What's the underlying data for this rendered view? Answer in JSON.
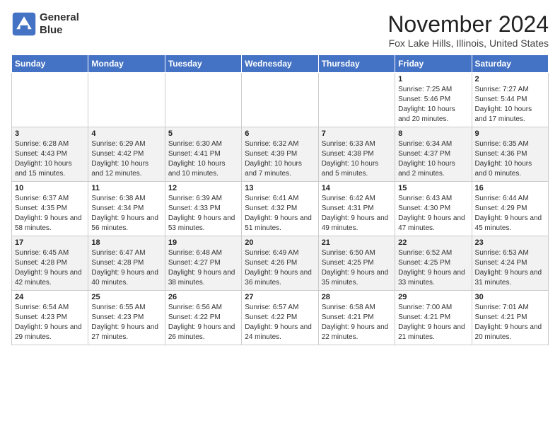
{
  "header": {
    "logo_line1": "General",
    "logo_line2": "Blue",
    "month": "November 2024",
    "location": "Fox Lake Hills, Illinois, United States"
  },
  "weekdays": [
    "Sunday",
    "Monday",
    "Tuesday",
    "Wednesday",
    "Thursday",
    "Friday",
    "Saturday"
  ],
  "weeks": [
    [
      {
        "day": "",
        "info": ""
      },
      {
        "day": "",
        "info": ""
      },
      {
        "day": "",
        "info": ""
      },
      {
        "day": "",
        "info": ""
      },
      {
        "day": "",
        "info": ""
      },
      {
        "day": "1",
        "info": "Sunrise: 7:25 AM\nSunset: 5:46 PM\nDaylight: 10 hours and 20 minutes."
      },
      {
        "day": "2",
        "info": "Sunrise: 7:27 AM\nSunset: 5:44 PM\nDaylight: 10 hours and 17 minutes."
      }
    ],
    [
      {
        "day": "3",
        "info": "Sunrise: 6:28 AM\nSunset: 4:43 PM\nDaylight: 10 hours and 15 minutes."
      },
      {
        "day": "4",
        "info": "Sunrise: 6:29 AM\nSunset: 4:42 PM\nDaylight: 10 hours and 12 minutes."
      },
      {
        "day": "5",
        "info": "Sunrise: 6:30 AM\nSunset: 4:41 PM\nDaylight: 10 hours and 10 minutes."
      },
      {
        "day": "6",
        "info": "Sunrise: 6:32 AM\nSunset: 4:39 PM\nDaylight: 10 hours and 7 minutes."
      },
      {
        "day": "7",
        "info": "Sunrise: 6:33 AM\nSunset: 4:38 PM\nDaylight: 10 hours and 5 minutes."
      },
      {
        "day": "8",
        "info": "Sunrise: 6:34 AM\nSunset: 4:37 PM\nDaylight: 10 hours and 2 minutes."
      },
      {
        "day": "9",
        "info": "Sunrise: 6:35 AM\nSunset: 4:36 PM\nDaylight: 10 hours and 0 minutes."
      }
    ],
    [
      {
        "day": "10",
        "info": "Sunrise: 6:37 AM\nSunset: 4:35 PM\nDaylight: 9 hours and 58 minutes."
      },
      {
        "day": "11",
        "info": "Sunrise: 6:38 AM\nSunset: 4:34 PM\nDaylight: 9 hours and 56 minutes."
      },
      {
        "day": "12",
        "info": "Sunrise: 6:39 AM\nSunset: 4:33 PM\nDaylight: 9 hours and 53 minutes."
      },
      {
        "day": "13",
        "info": "Sunrise: 6:41 AM\nSunset: 4:32 PM\nDaylight: 9 hours and 51 minutes."
      },
      {
        "day": "14",
        "info": "Sunrise: 6:42 AM\nSunset: 4:31 PM\nDaylight: 9 hours and 49 minutes."
      },
      {
        "day": "15",
        "info": "Sunrise: 6:43 AM\nSunset: 4:30 PM\nDaylight: 9 hours and 47 minutes."
      },
      {
        "day": "16",
        "info": "Sunrise: 6:44 AM\nSunset: 4:29 PM\nDaylight: 9 hours and 45 minutes."
      }
    ],
    [
      {
        "day": "17",
        "info": "Sunrise: 6:45 AM\nSunset: 4:28 PM\nDaylight: 9 hours and 42 minutes."
      },
      {
        "day": "18",
        "info": "Sunrise: 6:47 AM\nSunset: 4:28 PM\nDaylight: 9 hours and 40 minutes."
      },
      {
        "day": "19",
        "info": "Sunrise: 6:48 AM\nSunset: 4:27 PM\nDaylight: 9 hours and 38 minutes."
      },
      {
        "day": "20",
        "info": "Sunrise: 6:49 AM\nSunset: 4:26 PM\nDaylight: 9 hours and 36 minutes."
      },
      {
        "day": "21",
        "info": "Sunrise: 6:50 AM\nSunset: 4:25 PM\nDaylight: 9 hours and 35 minutes."
      },
      {
        "day": "22",
        "info": "Sunrise: 6:52 AM\nSunset: 4:25 PM\nDaylight: 9 hours and 33 minutes."
      },
      {
        "day": "23",
        "info": "Sunrise: 6:53 AM\nSunset: 4:24 PM\nDaylight: 9 hours and 31 minutes."
      }
    ],
    [
      {
        "day": "24",
        "info": "Sunrise: 6:54 AM\nSunset: 4:23 PM\nDaylight: 9 hours and 29 minutes."
      },
      {
        "day": "25",
        "info": "Sunrise: 6:55 AM\nSunset: 4:23 PM\nDaylight: 9 hours and 27 minutes."
      },
      {
        "day": "26",
        "info": "Sunrise: 6:56 AM\nSunset: 4:22 PM\nDaylight: 9 hours and 26 minutes."
      },
      {
        "day": "27",
        "info": "Sunrise: 6:57 AM\nSunset: 4:22 PM\nDaylight: 9 hours and 24 minutes."
      },
      {
        "day": "28",
        "info": "Sunrise: 6:58 AM\nSunset: 4:21 PM\nDaylight: 9 hours and 22 minutes."
      },
      {
        "day": "29",
        "info": "Sunrise: 7:00 AM\nSunset: 4:21 PM\nDaylight: 9 hours and 21 minutes."
      },
      {
        "day": "30",
        "info": "Sunrise: 7:01 AM\nSunset: 4:21 PM\nDaylight: 9 hours and 20 minutes."
      }
    ]
  ]
}
